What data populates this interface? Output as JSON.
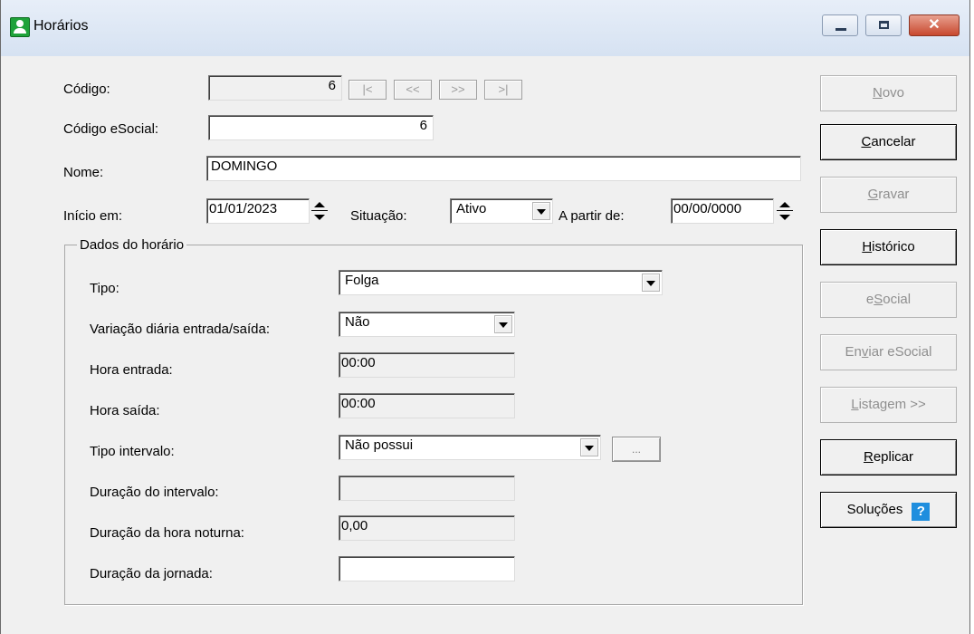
{
  "window": {
    "title": "Horários"
  },
  "header": {
    "codigo_label": "Código:",
    "codigo_value": "6",
    "nav": [
      "|<",
      "<<",
      ">>",
      ">|"
    ],
    "codigo_esocial_label": "Código eSocial:",
    "codigo_esocial_value": "6",
    "nome_label": "Nome:",
    "nome_value": "DOMINGO",
    "inicio_label": "Início em:",
    "inicio_value": "01/01/2023",
    "situacao_label": "Situação:",
    "situacao_value": "Ativo",
    "a_partir_label": "A partir de:",
    "a_partir_value": "00/00/0000"
  },
  "group": {
    "title": "Dados do horário",
    "tipo_label": "Tipo:",
    "tipo_value": "Folga",
    "variacao_label": "Variação diária entrada/saída:",
    "variacao_value": "Não",
    "hora_entrada_label": "Hora entrada:",
    "hora_entrada_value": "00:00",
    "hora_saida_label": "Hora saída:",
    "hora_saida_value": "00:00",
    "tipo_intervalo_label": "Tipo intervalo:",
    "tipo_intervalo_value": "Não possui",
    "ellipsis_label": "...",
    "duracao_intervalo_label": "Duração do intervalo:",
    "duracao_intervalo_value": "",
    "duracao_noturna_label": "Duração da hora noturna:",
    "duracao_noturna_value": "0,00",
    "duracao_jornada_label": "Duração da jornada:",
    "duracao_jornada_value": ""
  },
  "side_buttons": {
    "novo": {
      "first": "N",
      "rest": "ovo"
    },
    "cancelar": {
      "first": "C",
      "rest": "ancelar"
    },
    "gravar": {
      "first": "G",
      "rest": "ravar"
    },
    "historico": {
      "first": "H",
      "rest": "istórico"
    },
    "esocial": {
      "pre": "e",
      "u": "S",
      "post": "ocial"
    },
    "enviar": {
      "pre": "En",
      "u": "v",
      "post": "iar eSocial"
    },
    "listagem": {
      "first": "L",
      "rest": "istagem >>"
    },
    "replicar": {
      "first": "R",
      "rest": "eplicar"
    },
    "solucoes": "Soluções",
    "help_glyph": "?"
  }
}
